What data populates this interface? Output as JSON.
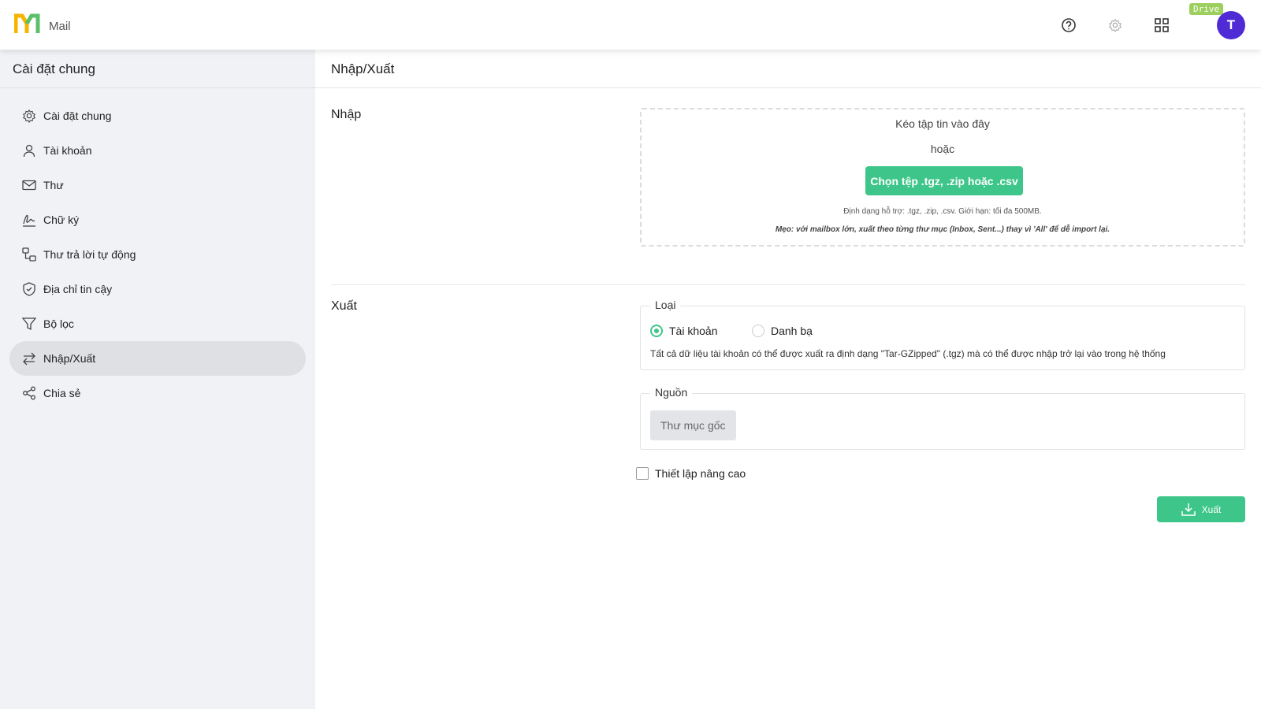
{
  "header": {
    "app_name": "Mail",
    "drive_badge": "Drive",
    "avatar_letter": "T",
    "icons": [
      "help-icon",
      "gear-icon",
      "apps-grid-icon"
    ]
  },
  "sidebar": {
    "title": "Cài đặt chung",
    "items": [
      {
        "label": "Cài đặt chung",
        "icon": "gear-icon"
      },
      {
        "label": "Tài khoản",
        "icon": "user-icon"
      },
      {
        "label": "Thư",
        "icon": "mail-icon"
      },
      {
        "label": "Chữ ký",
        "icon": "signature-icon"
      },
      {
        "label": "Thư trả lời tự động",
        "icon": "auto-reply-icon"
      },
      {
        "label": "Địa chỉ tin cậy",
        "icon": "shield-icon"
      },
      {
        "label": "Bộ lọc",
        "icon": "filter-icon"
      },
      {
        "label": "Nhập/Xuất",
        "icon": "import-export-icon",
        "active": true
      },
      {
        "label": "Chia sẻ",
        "icon": "share-icon"
      }
    ]
  },
  "main": {
    "title": "Nhập/Xuất",
    "import": {
      "label": "Nhập",
      "drop_text": "Kéo tập tin vào đây",
      "or_text": "hoặc",
      "choose_button": "Chọn tệp .tgz, .zip hoặc .csv",
      "formats_note": "Định dạng hỗ trợ: .tgz, .zip, .csv. Giới hạn: tối đa 500MB.",
      "tip": "Mẹo: với mailbox lớn, xuất theo từng thư mục (Inbox, Sent...) thay vì 'All' để dễ import lại."
    },
    "export": {
      "label": "Xuất",
      "type_legend": "Loại",
      "type_options": [
        {
          "label": "Tài khoản",
          "selected": true
        },
        {
          "label": "Danh bạ",
          "selected": false
        }
      ],
      "type_description": "Tất cả dữ liệu tài khoản có thể được xuất ra định dạng \"Tar-GZipped\" (.tgz) mà có thể được nhập trở lại vào trong hệ thống",
      "source_legend": "Nguồn",
      "source_button": "Thư mục gốc",
      "advanced_label": "Thiết lập nâng cao",
      "advanced_checked": false,
      "export_button": "Xuất"
    }
  },
  "colors": {
    "accent": "#3ec68a",
    "avatar": "#4f2bd6",
    "badge": "#9ccf5e",
    "sidebar_bg": "#f1f2f6"
  }
}
